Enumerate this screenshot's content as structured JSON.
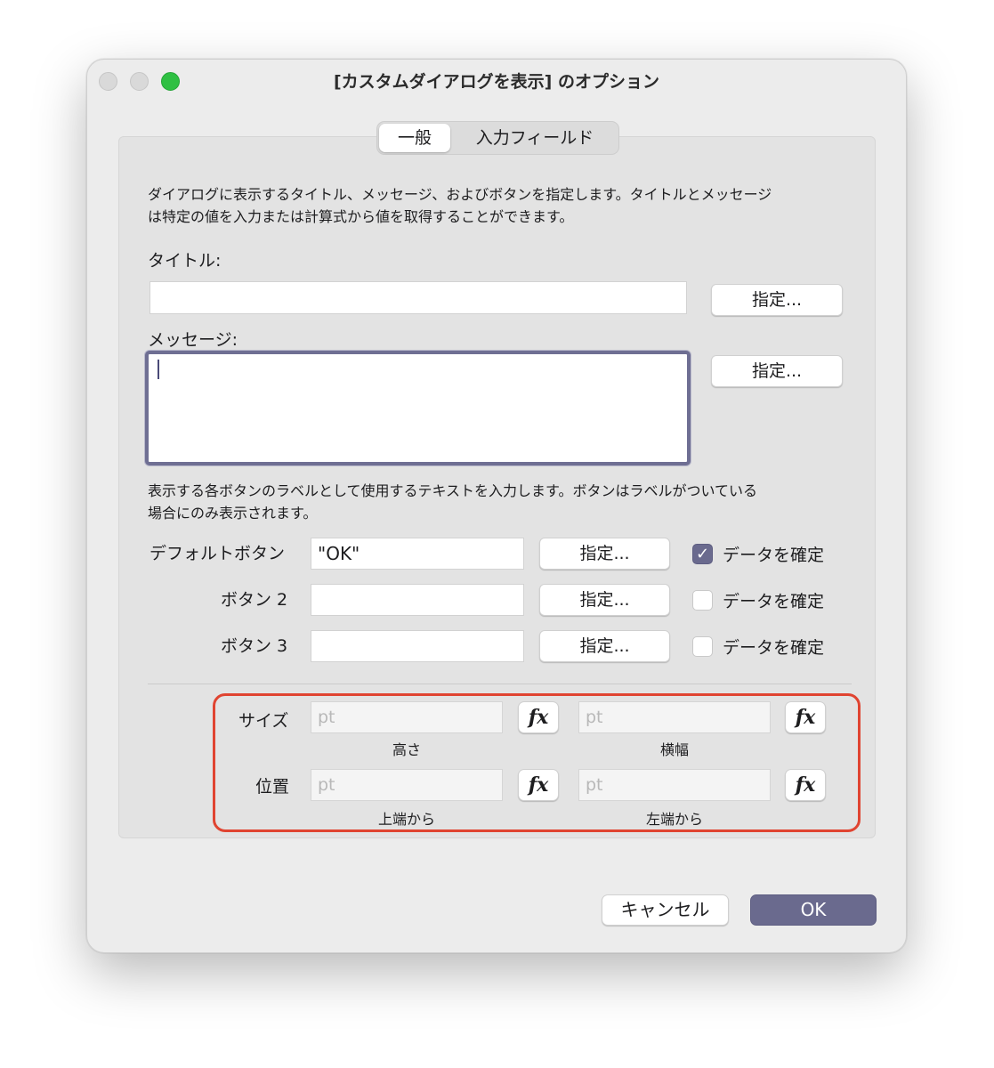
{
  "window": {
    "title": "[カスタムダイアログを表示] のオプション"
  },
  "tabs": [
    {
      "label": "一般",
      "active": true
    },
    {
      "label": "入力フィールド",
      "active": false
    }
  ],
  "general": {
    "description": "ダイアログに表示するタイトル、メッセージ、およびボタンを指定します。タイトルとメッセージは特定の値を入力または計算式から値を取得することができます。",
    "description_line1": "ダイアログに表示するタイトル、メッセージ、およびボタンを指定します。タイトルとメッセージ",
    "description_line2": "は特定の値を入力または計算式から値を取得することができます。",
    "title_label": "タイトル:",
    "title_value": "",
    "message_label": "メッセージ:",
    "message_value": "",
    "specify_label": "指定...",
    "buttons_desc_line1": "表示する各ボタンのラベルとして使用するテキストを入力します。ボタンはラベルがついている",
    "buttons_desc_line2": "場合にのみ表示されます。"
  },
  "buttons": [
    {
      "label": "デフォルトボタン",
      "value": "\"OK\"",
      "specify": "指定...",
      "commit_label": "データを確定",
      "commit_checked": true
    },
    {
      "label": "ボタン 2",
      "value": "",
      "specify": "指定...",
      "commit_label": "データを確定",
      "commit_checked": false
    },
    {
      "label": "ボタン 3",
      "value": "",
      "specify": "指定...",
      "commit_label": "データを確定",
      "commit_checked": false
    }
  ],
  "geometry": {
    "size_label": "サイズ",
    "position_label": "位置",
    "placeholder": "pt",
    "fx_label": "fx",
    "height_caption": "高さ",
    "width_caption": "横幅",
    "top_caption": "上端から",
    "left_caption": "左端から"
  },
  "footer": {
    "cancel_label": "キャンセル",
    "ok_label": "OK"
  },
  "colors": {
    "accent": "#6a6a8e",
    "highlight": "#e04431",
    "zoom": "#2fc043"
  }
}
